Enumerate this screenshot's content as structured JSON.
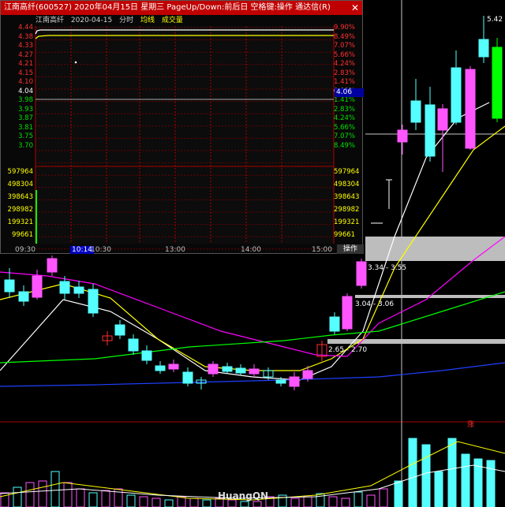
{
  "popup": {
    "title": "江南高纤(600527) 2020年04月15日 星期三 PageUp/Down:前后日 空格键:操作 通达信(R)",
    "close_glyph": "✕",
    "stock_name": "江南高纤",
    "date": "2020-04-15",
    "mode": "分时",
    "avg_label": "均线",
    "vol_label": "成交量",
    "price_labels": [
      "4.44",
      "4.38",
      "4.33",
      "4.27",
      "4.21",
      "4.15",
      "4.10",
      "4.04",
      "3.98",
      "3.93",
      "3.87",
      "3.81",
      "3.75",
      "3.70"
    ],
    "pct_labels": [
      "9.90%",
      "8.49%",
      "7.07%",
      "5.66%",
      "4.24%",
      "2.83%",
      "1.41%",
      "0.00%",
      "1.41%",
      "2.83%",
      "4.24%",
      "5.66%",
      "7.07%",
      "8.49%"
    ],
    "vol_labels": [
      "597964",
      "498304",
      "398643",
      "298982",
      "199321",
      "99661"
    ],
    "time_labels": [
      "09:30",
      "10:14",
      "10:30",
      "13:00",
      "14:00",
      "15:00"
    ],
    "op_label": "操作",
    "current_price": "4.06"
  },
  "main": {
    "top_right_value": "5.42",
    "zones": [
      "3.34 - 3.55",
      "3.04 - 3.06",
      "2.65 - 2.70"
    ],
    "zhang_label": "涨",
    "watermark": "HuangQN"
  },
  "colors": {
    "up": "#ff55ff",
    "down": "#55ffff",
    "red": "#ff3030",
    "white": "#ffffff",
    "yellow": "#ffff00",
    "magenta": "#ff00ff",
    "green": "#00ff00",
    "blue": "#2040ff",
    "gray": "#c8c8c8"
  }
}
